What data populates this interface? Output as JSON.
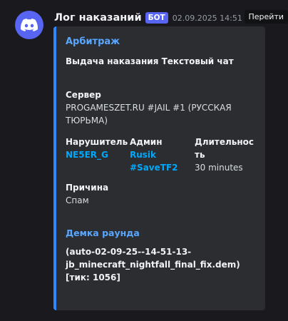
{
  "header": {
    "author": "Лог наказаний",
    "bot_tag": "БОТ",
    "timestamp": "02.09.2025 14:51",
    "goto_label": "Перейти"
  },
  "embed": {
    "accent_color": "#2f88ff",
    "author": "Арбитраж",
    "title": "Выдача наказания Текстовый чат",
    "fields": {
      "server": {
        "name": "Сервер",
        "value_line1": "PROGAMESZET.RU #JAIL #1 (РУССКАЯ",
        "value_line2": "ТЮРЬМА)"
      },
      "offender": {
        "name": "Нарушитель",
        "value": "NE5ER_G"
      },
      "admin": {
        "name": "Админ",
        "value_line1": "Rusik",
        "value_line2": "#SaveTF2"
      },
      "duration": {
        "name_line1": "Длительнос",
        "name_line2": "ть",
        "value": "30 minutes"
      },
      "reason": {
        "name": "Причина",
        "value": "Спам"
      },
      "demo": {
        "name": "Демка раунда",
        "value_line1": "(auto-02-09-25--14-51-13-",
        "value_line2": "jb_minecraft_nightfall_final_fix.dem)",
        "value_line3": "[тик: 1056]"
      }
    }
  },
  "icons": {
    "avatar": "discord-logo-icon"
  }
}
